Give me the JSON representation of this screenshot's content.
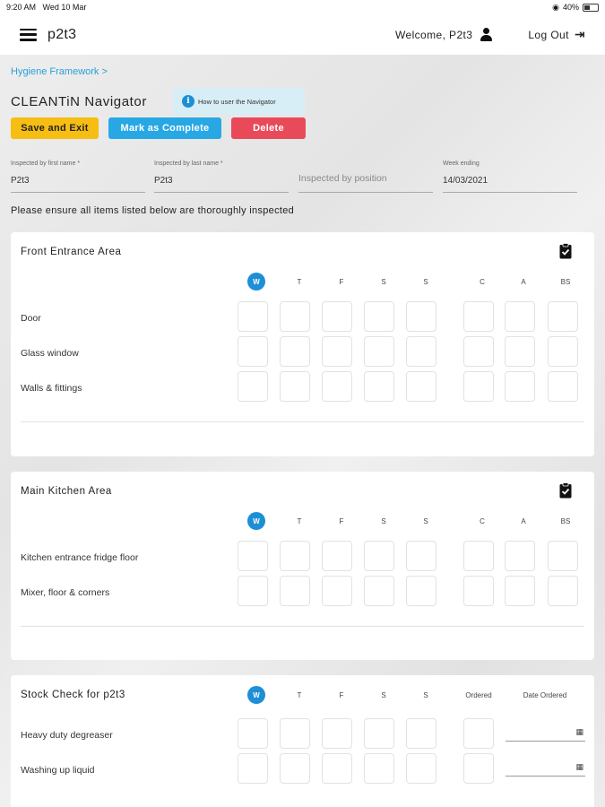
{
  "status_bar": {
    "time": "9:20 AM",
    "date": "Wed 10 Mar",
    "battery": "40%"
  },
  "app_bar": {
    "title": "p2t3",
    "welcome": "Welcome, P2t3",
    "logout": "Log Out"
  },
  "breadcrumb": {
    "label": "Hygiene Framework",
    "chevron": ">"
  },
  "page": {
    "title": "CLEANTiN Navigator",
    "help_label": "How to user the Navigator"
  },
  "buttons": {
    "save": "Save and Exit",
    "complete": "Mark as Complete",
    "delete": "Delete"
  },
  "colors": {
    "save": "#f6bd12",
    "complete": "#27a8e4",
    "delete": "#e84a5a",
    "accent": "#1e8fd6"
  },
  "fields": {
    "first_name": {
      "label": "Inspected by first name *",
      "value": "P2t3"
    },
    "last_name": {
      "label": "Inspected by last name *",
      "value": "P2t3"
    },
    "position": {
      "placeholder": "Inspected by position"
    },
    "week_ending": {
      "label": "Week ending",
      "value": "14/03/2021"
    }
  },
  "instruction": "Please ensure all items listed below are thoroughly inspected",
  "day_columns": [
    "W",
    "T",
    "F",
    "S",
    "S"
  ],
  "extra_columns": [
    "C",
    "A",
    "BS"
  ],
  "sections": [
    {
      "title": "Front Entrance Area",
      "rows": [
        "Door",
        "Glass window",
        "Walls & fittings"
      ]
    },
    {
      "title": "Main Kitchen Area",
      "rows": [
        "Kitchen entrance fridge floor",
        "Mixer, floor & corners"
      ]
    }
  ],
  "stock": {
    "title": "Stock Check for p2t3",
    "ordered_label": "Ordered",
    "date_label": "Date Ordered",
    "rows": [
      "Heavy duty degreaser",
      "Washing up liquid"
    ]
  },
  "icons": {
    "menu": "hamburger-icon",
    "user": "user-icon",
    "logout": "logout-icon",
    "info": "info-icon",
    "clipboard": "clipboard-check-icon",
    "calendar": "calendar-icon"
  }
}
